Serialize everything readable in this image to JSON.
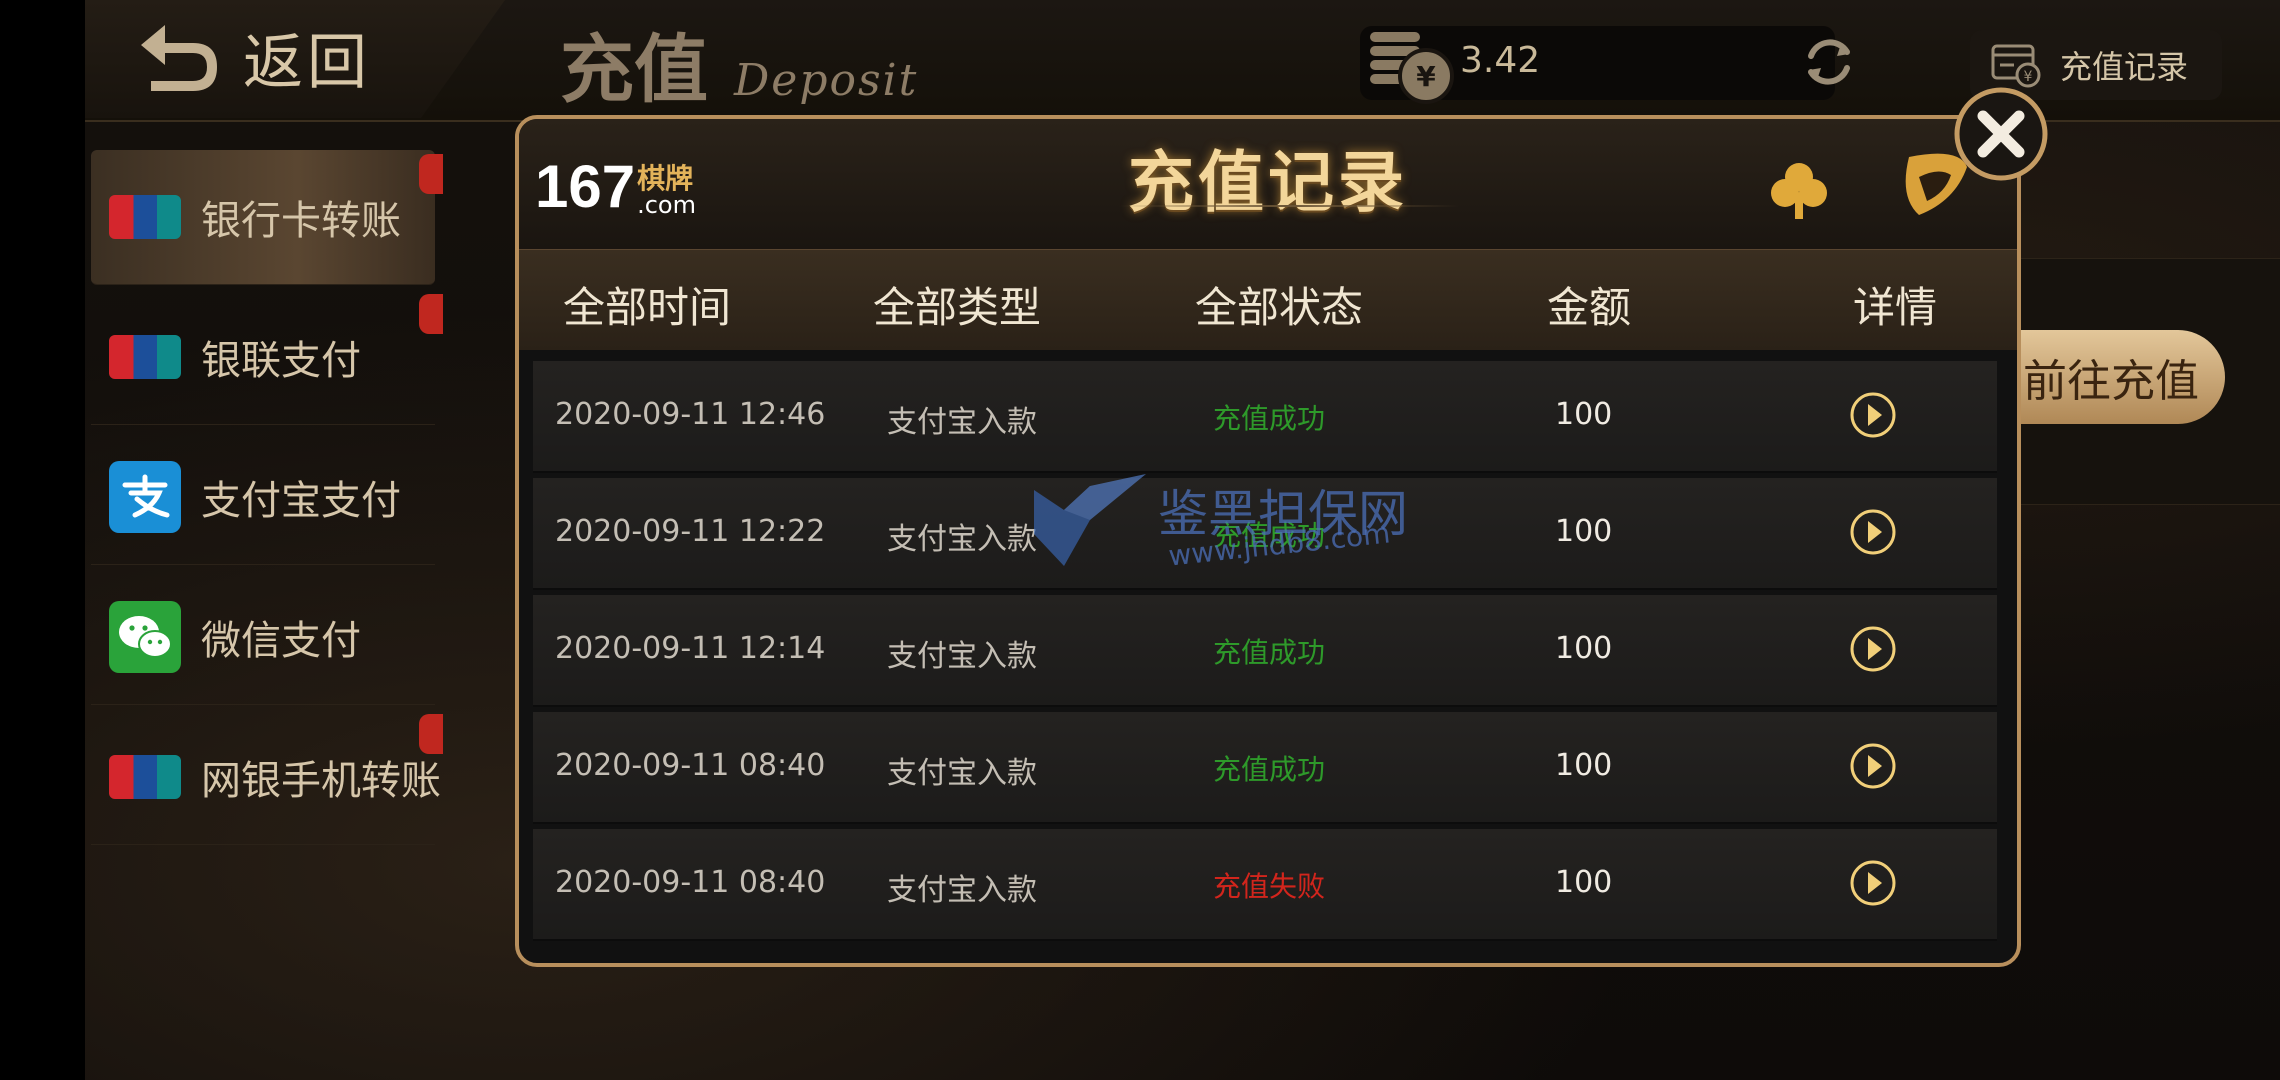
{
  "header": {
    "back_label": "返回",
    "title_cn": "充值",
    "title_en": "Deposit",
    "balance": "3.42",
    "records_label": "充值记录",
    "coin_symbol": "¥"
  },
  "sidebar": {
    "items": [
      {
        "label": "银行卡转账",
        "icon": "unionpay-icon"
      },
      {
        "label": "银联支付",
        "icon": "unionpay-icon"
      },
      {
        "label": "支付宝支付",
        "icon": "alipay-icon"
      },
      {
        "label": "微信支付",
        "icon": "wechat-icon"
      },
      {
        "label": "网银手机转账",
        "icon": "unionpay-icon"
      }
    ]
  },
  "main": {
    "goto_button": "前往充值"
  },
  "modal": {
    "title": "充值记录",
    "logo_number": "167",
    "logo_cn": "棋牌",
    "logo_dotcom": ".com",
    "columns": [
      "全部时间",
      "全部类型",
      "全部状态",
      "金额",
      "详情"
    ],
    "rows": [
      {
        "time": "2020-09-11 12:46",
        "type": "支付宝入款",
        "status": "充值成功",
        "status_color": "#2e9a2a",
        "amount": "100"
      },
      {
        "time": "2020-09-11 12:22",
        "type": "支付宝入款",
        "status": "充值成功",
        "status_color": "#2e9a2a",
        "amount": "100"
      },
      {
        "time": "2020-09-11 12:14",
        "type": "支付宝入款",
        "status": "充值成功",
        "status_color": "#2e9a2a",
        "amount": "100"
      },
      {
        "time": "2020-09-11 08:40",
        "type": "支付宝入款",
        "status": "充值成功",
        "status_color": "#2e9a2a",
        "amount": "100"
      },
      {
        "time": "2020-09-11 08:40",
        "type": "支付宝入款",
        "status": "充值失败",
        "status_color": "#d2251c",
        "amount": "100"
      }
    ]
  },
  "watermark": {
    "text": "鉴黑担保网",
    "url": "www.jhdb8.com"
  },
  "colors": {
    "accent_gold": "#b88f5c",
    "success": "#2e9a2a",
    "fail": "#d2251c"
  }
}
